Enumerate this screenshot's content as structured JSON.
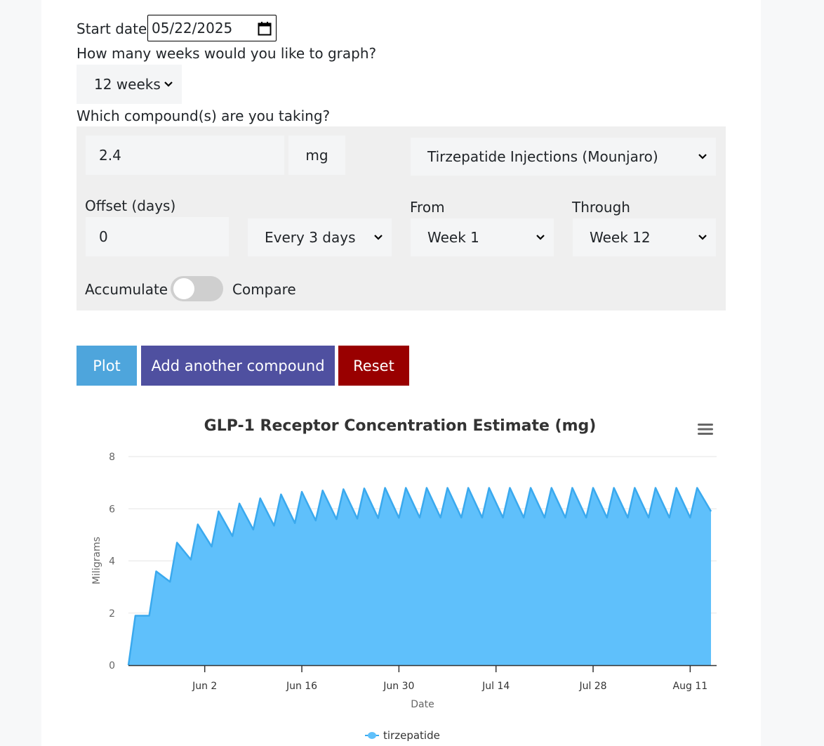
{
  "form": {
    "start_date_label": "Start date:",
    "start_date_value": "05/22/2025",
    "weeks_question": "How many weeks would you like to graph?",
    "weeks_selected": "12 weeks",
    "compound_question": "Which compound(s) are you taking?"
  },
  "compound": {
    "dose_value": "2.4",
    "unit": "mg",
    "compound_selected": "Tirzepatide Injections (Mounjaro)",
    "offset_label": "Offset (days)",
    "offset_value": "0",
    "frequency_selected": "Every 3 days",
    "from_label": "From",
    "from_selected": "Week 1",
    "through_label": "Through",
    "through_selected": "Week 12",
    "accumulate_label": "Accumulate",
    "compare_label": "Compare",
    "toggle_on": false
  },
  "buttons": {
    "plot": "Plot",
    "add": "Add another compound",
    "reset": "Reset"
  },
  "colors": {
    "plot_button": "#4ea5dc",
    "add_button": "#4f50a0",
    "reset_button": "#990000",
    "series_fill": "#5fc0fb",
    "series_line": "#3aa9ee"
  },
  "chart_data": {
    "type": "area",
    "title": "GLP-1 Receptor Concentration Estimate (mg)",
    "xlabel": "Date",
    "ylabel": "Miligrams",
    "ylim": [
      0,
      8
    ],
    "yticks": [
      "0",
      "2",
      "4",
      "6",
      "8"
    ],
    "xticks": [
      {
        "date": "2025-06-02",
        "label": "Jun 2"
      },
      {
        "date": "2025-06-16",
        "label": "Jun 16"
      },
      {
        "date": "2025-06-30",
        "label": "Jun 30"
      },
      {
        "date": "2025-07-14",
        "label": "Jul 14"
      },
      {
        "date": "2025-07-28",
        "label": "Jul 28"
      },
      {
        "date": "2025-08-11",
        "label": "Aug 11"
      }
    ],
    "x_start": "2025-05-22",
    "x_end": "2025-08-14",
    "legend_position": "bottom-center",
    "grid": true,
    "series": [
      {
        "name": "tirzepatide",
        "points": [
          [
            "2025-05-22",
            0.0
          ],
          [
            "2025-05-23",
            1.9
          ],
          [
            "2025-05-25",
            1.9
          ],
          [
            "2025-05-26",
            3.6
          ],
          [
            "2025-05-28",
            3.2
          ],
          [
            "2025-05-29",
            4.7
          ],
          [
            "2025-05-31",
            4.05
          ],
          [
            "2025-06-01",
            5.4
          ],
          [
            "2025-06-03",
            4.55
          ],
          [
            "2025-06-04",
            5.9
          ],
          [
            "2025-06-06",
            4.95
          ],
          [
            "2025-06-07",
            6.2
          ],
          [
            "2025-06-09",
            5.2
          ],
          [
            "2025-06-10",
            6.4
          ],
          [
            "2025-06-12",
            5.35
          ],
          [
            "2025-06-13",
            6.55
          ],
          [
            "2025-06-15",
            5.45
          ],
          [
            "2025-06-16",
            6.65
          ],
          [
            "2025-06-18",
            5.55
          ],
          [
            "2025-06-19",
            6.7
          ],
          [
            "2025-06-21",
            5.6
          ],
          [
            "2025-06-22",
            6.75
          ],
          [
            "2025-06-24",
            5.62
          ],
          [
            "2025-06-25",
            6.78
          ],
          [
            "2025-06-27",
            5.64
          ],
          [
            "2025-06-28",
            6.8
          ],
          [
            "2025-06-30",
            5.65
          ],
          [
            "2025-07-01",
            6.8
          ],
          [
            "2025-07-03",
            5.66
          ],
          [
            "2025-07-04",
            6.8
          ],
          [
            "2025-07-06",
            5.66
          ],
          [
            "2025-07-07",
            6.8
          ],
          [
            "2025-07-09",
            5.66
          ],
          [
            "2025-07-10",
            6.8
          ],
          [
            "2025-07-12",
            5.66
          ],
          [
            "2025-07-13",
            6.8
          ],
          [
            "2025-07-15",
            5.66
          ],
          [
            "2025-07-16",
            6.8
          ],
          [
            "2025-07-18",
            5.66
          ],
          [
            "2025-07-19",
            6.8
          ],
          [
            "2025-07-21",
            5.66
          ],
          [
            "2025-07-22",
            6.8
          ],
          [
            "2025-07-24",
            5.66
          ],
          [
            "2025-07-25",
            6.8
          ],
          [
            "2025-07-27",
            5.66
          ],
          [
            "2025-07-28",
            6.8
          ],
          [
            "2025-07-30",
            5.66
          ],
          [
            "2025-07-31",
            6.8
          ],
          [
            "2025-08-02",
            5.66
          ],
          [
            "2025-08-03",
            6.8
          ],
          [
            "2025-08-05",
            5.66
          ],
          [
            "2025-08-06",
            6.8
          ],
          [
            "2025-08-08",
            5.66
          ],
          [
            "2025-08-09",
            6.8
          ],
          [
            "2025-08-11",
            5.66
          ],
          [
            "2025-08-12",
            6.8
          ],
          [
            "2025-08-14",
            5.9
          ]
        ]
      }
    ]
  }
}
